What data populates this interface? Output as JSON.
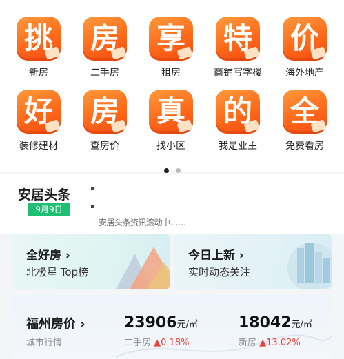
{
  "grid": {
    "items": [
      {
        "glyph": "挑",
        "label": "新房"
      },
      {
        "glyph": "房",
        "label": "二手房"
      },
      {
        "glyph": "享",
        "label": "租房"
      },
      {
        "glyph": "特",
        "label": "商铺写字楼"
      },
      {
        "glyph": "价",
        "label": "海外地产"
      },
      {
        "glyph": "好",
        "label": "装修建材"
      },
      {
        "glyph": "房",
        "label": "查房价"
      },
      {
        "glyph": "真",
        "label": "找小区"
      },
      {
        "glyph": "的",
        "label": "我是业主"
      },
      {
        "glyph": "全",
        "label": "免费看房"
      }
    ]
  },
  "pager": {
    "active_color": "#222222",
    "inactive_color": "#bbbbbb"
  },
  "news": {
    "title": "安居头条",
    "date": "9月9日",
    "ticker": "安居头条资讯滚动中……"
  },
  "promos": [
    {
      "title": "全好房 ›",
      "subtitle": "北极星 Top榜"
    },
    {
      "title": "今日上新 ›",
      "subtitle": "实时动态关注"
    }
  ],
  "price": {
    "title": "福州房价 ›",
    "subtitle": "城市行情",
    "second_hand": {
      "value": "23906",
      "unit": "元/㎡",
      "label": "二手房",
      "change": "▲0.18%"
    },
    "new_house": {
      "value": "18042",
      "unit": "元/㎡",
      "label": "新房",
      "change": "▲13.02%"
    }
  },
  "colors": {
    "accent_orange": "#ff6a1a",
    "date_green": "#1fbf73",
    "up_red": "#e8423a"
  }
}
